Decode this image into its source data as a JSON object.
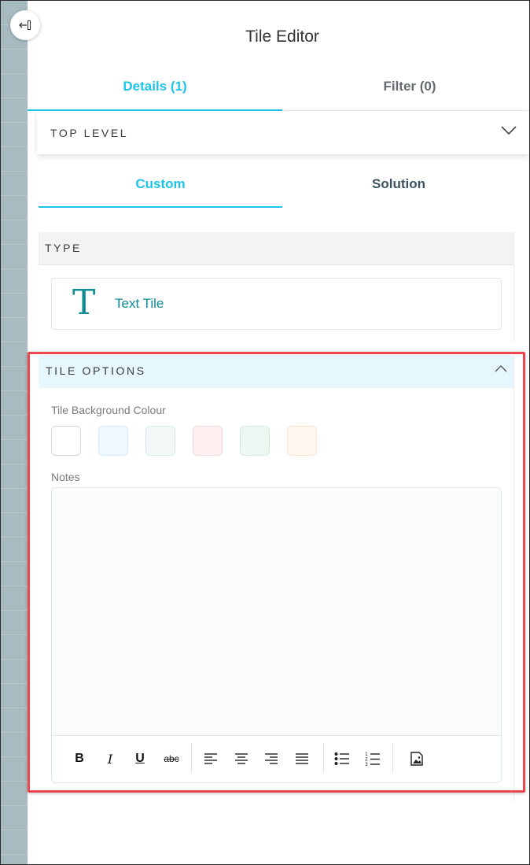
{
  "panel": {
    "title": "Tile Editor",
    "back_icon": "collapse-panel-icon"
  },
  "top_tabs": [
    {
      "label": "Details (1)",
      "active": true
    },
    {
      "label": "Filter (0)",
      "active": false
    }
  ],
  "top_level": {
    "label": "TOP LEVEL",
    "icon": "chevron-down-icon"
  },
  "sub_tabs": [
    {
      "label": "Custom",
      "active": true
    },
    {
      "label": "Solution",
      "active": false
    }
  ],
  "type_section": {
    "header": "TYPE",
    "card": {
      "glyph": "T",
      "label": "Text Tile"
    }
  },
  "tile_options": {
    "header": "TILE OPTIONS",
    "icon": "chevron-up-icon",
    "background_label": "Tile Background Colour",
    "swatches": [
      "#ffffff",
      "#eefaff",
      "#f2f8f7",
      "#fff0f2",
      "#eef8f3",
      "#fff8ee"
    ],
    "notes_label": "Notes",
    "notes_value": "",
    "toolbar": {
      "bold": "B",
      "italic": "I",
      "underline": "U",
      "strike": "abc"
    }
  },
  "colors": {
    "accent": "#1ec3ea",
    "teal": "#0f8c96",
    "highlight": "#e8484e"
  }
}
